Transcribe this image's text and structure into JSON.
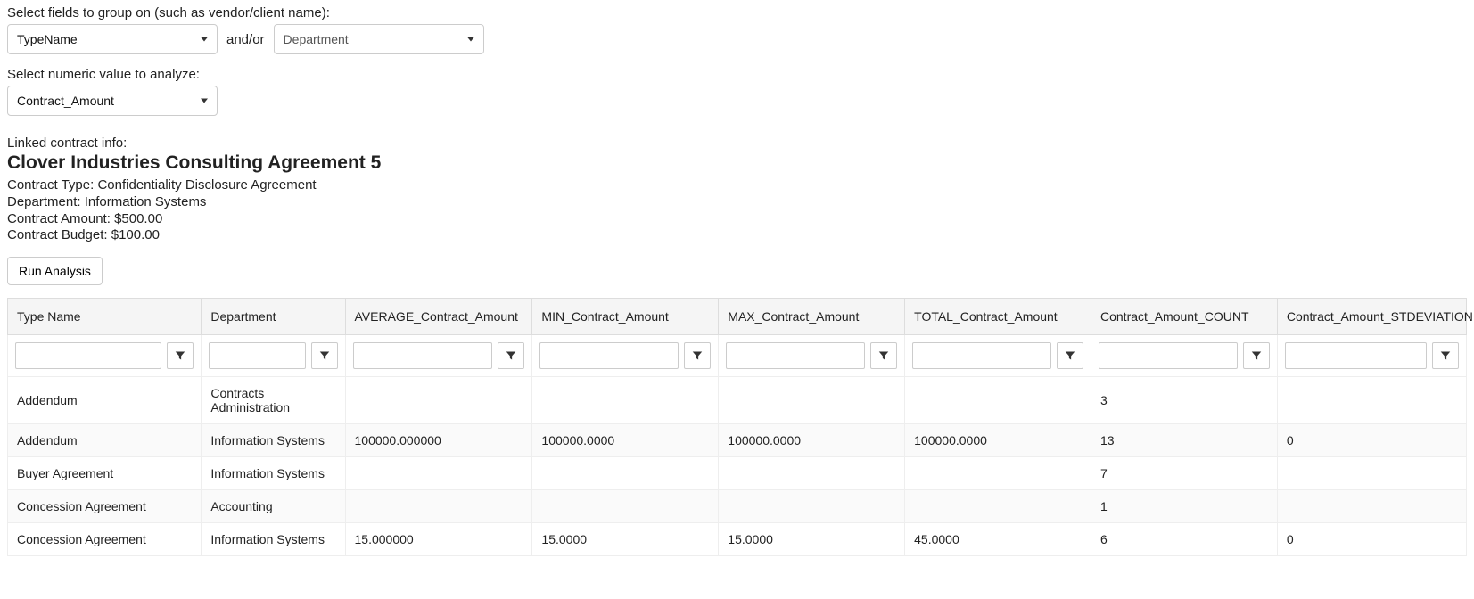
{
  "groupFields": {
    "label": "Select fields to group on (such as vendor/client name):",
    "select1": "TypeName",
    "andor": "and/or",
    "select2": "Department"
  },
  "numericValue": {
    "label": "Select numeric value to analyze:",
    "select": "Contract_Amount"
  },
  "linked": {
    "label": "Linked contract info:",
    "title": "Clover Industries Consulting Agreement 5",
    "type_line_label": "Contract Type: ",
    "type_value": "Confidentiality Disclosure Agreement",
    "dept_line_label": "Department: ",
    "dept_value": "Information Systems",
    "amount_line_label": "Contract Amount: ",
    "amount_value": "$500.00",
    "budget_line_label": "Contract Budget: ",
    "budget_value": "$100.00"
  },
  "runBtn": "Run Analysis",
  "table": {
    "headers": [
      "Type Name",
      "Department",
      "AVERAGE_Contract_Amount",
      "MIN_Contract_Amount",
      "MAX_Contract_Amount",
      "TOTAL_Contract_Amount",
      "Contract_Amount_COUNT",
      "Contract_Amount_STDEVIATION"
    ],
    "rows": [
      {
        "c0": "Addendum",
        "c1": "Contracts Administration",
        "c2": "",
        "c3": "",
        "c4": "",
        "c5": "",
        "c6": "3",
        "c7": ""
      },
      {
        "c0": "Addendum",
        "c1": "Information Systems",
        "c2": "100000.000000",
        "c3": "100000.0000",
        "c4": "100000.0000",
        "c5": "100000.0000",
        "c6": "13",
        "c7": "0"
      },
      {
        "c0": "Buyer Agreement",
        "c1": "Information Systems",
        "c2": "",
        "c3": "",
        "c4": "",
        "c5": "",
        "c6": "7",
        "c7": ""
      },
      {
        "c0": "Concession Agreement",
        "c1": "Accounting",
        "c2": "",
        "c3": "",
        "c4": "",
        "c5": "",
        "c6": "1",
        "c7": ""
      },
      {
        "c0": "Concession Agreement",
        "c1": "Information Systems",
        "c2": "15.000000",
        "c3": "15.0000",
        "c4": "15.0000",
        "c5": "45.0000",
        "c6": "6",
        "c7": "0"
      }
    ]
  }
}
